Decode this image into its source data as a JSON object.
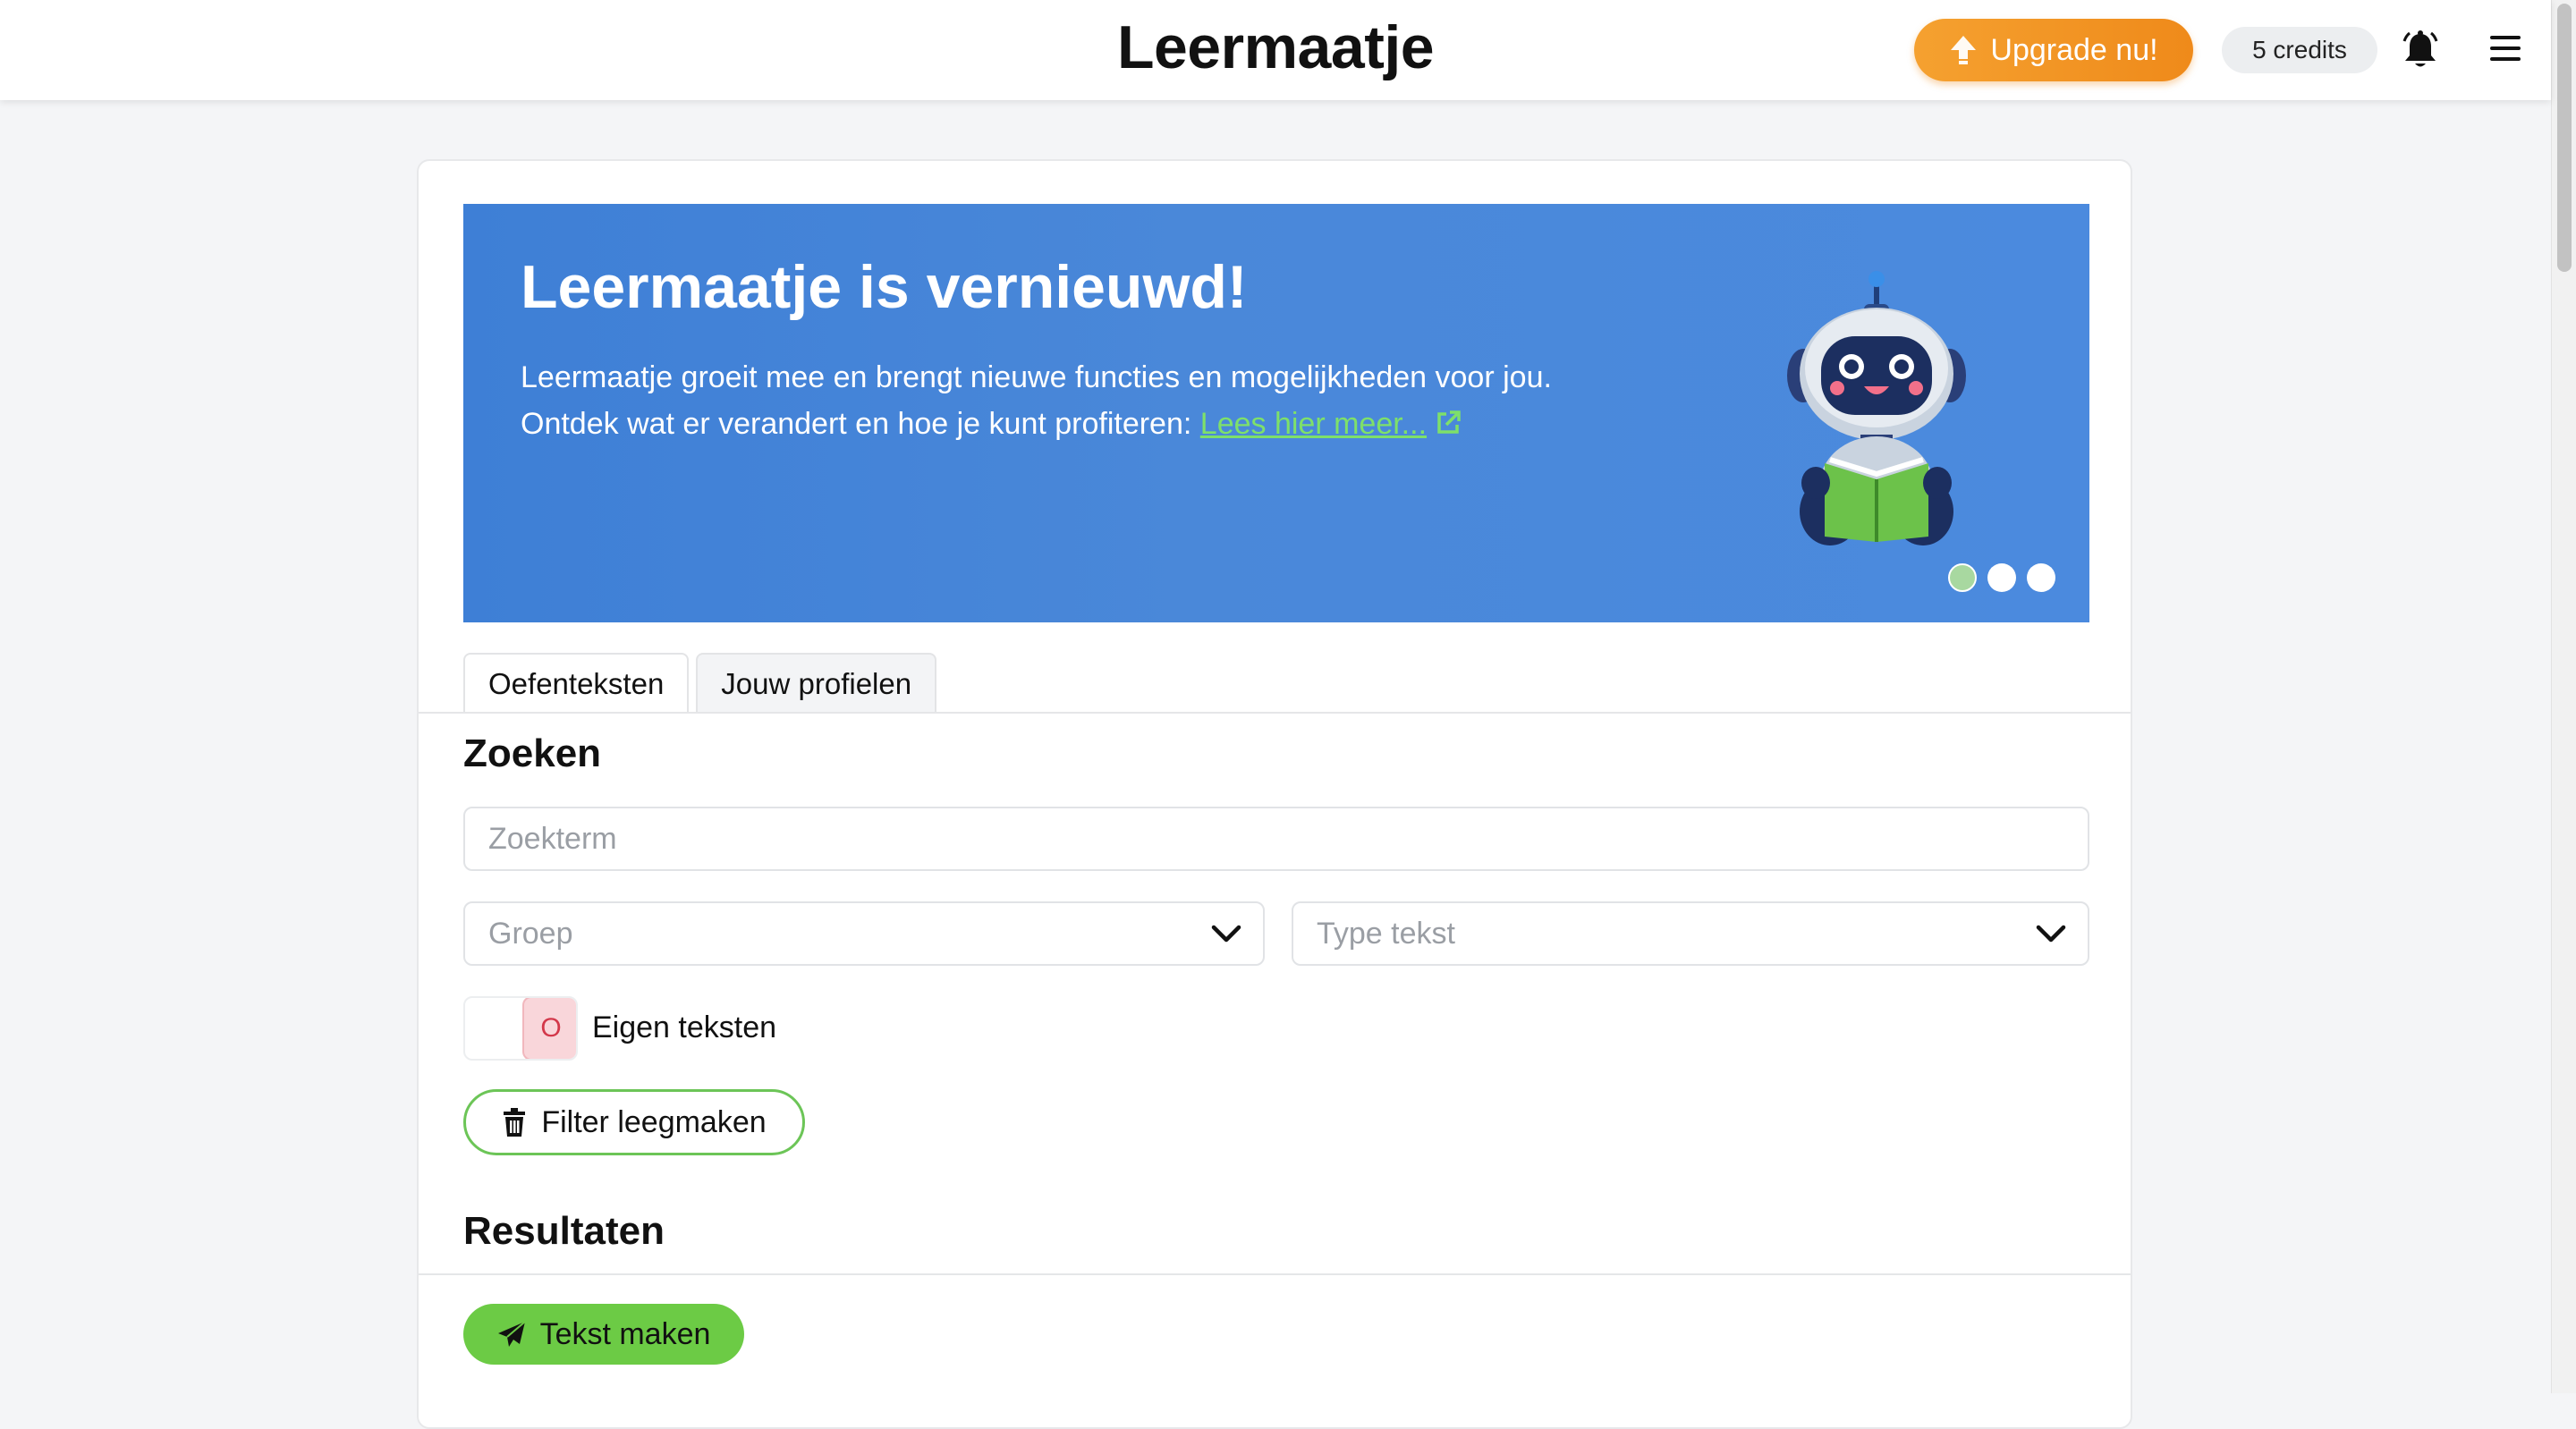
{
  "header": {
    "brand": "Leermaatje",
    "upgrade_label": "Upgrade nu!",
    "credits_label": "5 credits",
    "upgrade_icon": "upload-arrow-icon",
    "bell_icon": "bell-icon",
    "menu_icon": "hamburger-menu-icon"
  },
  "banner": {
    "title": "Leermaatje is vernieuwd!",
    "line1": "Leermaatje groeit mee en brengt nieuwe functies en mogelijkheden voor jou.",
    "line2": "Ontdek wat er verandert en hoe je kunt profiteren: ",
    "link_label": "Lees hier meer...",
    "slides_total": 3,
    "active_slide": 1,
    "background_color": "#4a88d9",
    "link_color": "#7ee06a"
  },
  "tabs": [
    {
      "label": "Oefenteksten",
      "active": true
    },
    {
      "label": "Jouw profielen",
      "active": false
    }
  ],
  "search": {
    "title": "Zoeken",
    "term_placeholder": "Zoekterm",
    "group_placeholder": "Groep",
    "type_placeholder": "Type tekst",
    "own_texts_label": "Eigen teksten",
    "own_texts_toggle_mark": "O",
    "own_texts_enabled": false,
    "clear_filter_label": "Filter leegmaken"
  },
  "results": {
    "title": "Resultaten",
    "make_text_label": "Tekst maken"
  },
  "colors": {
    "accent_orange": "#ef8a1a",
    "accent_green": "#6ccb45",
    "toggle_off_red": "#d3384a"
  }
}
